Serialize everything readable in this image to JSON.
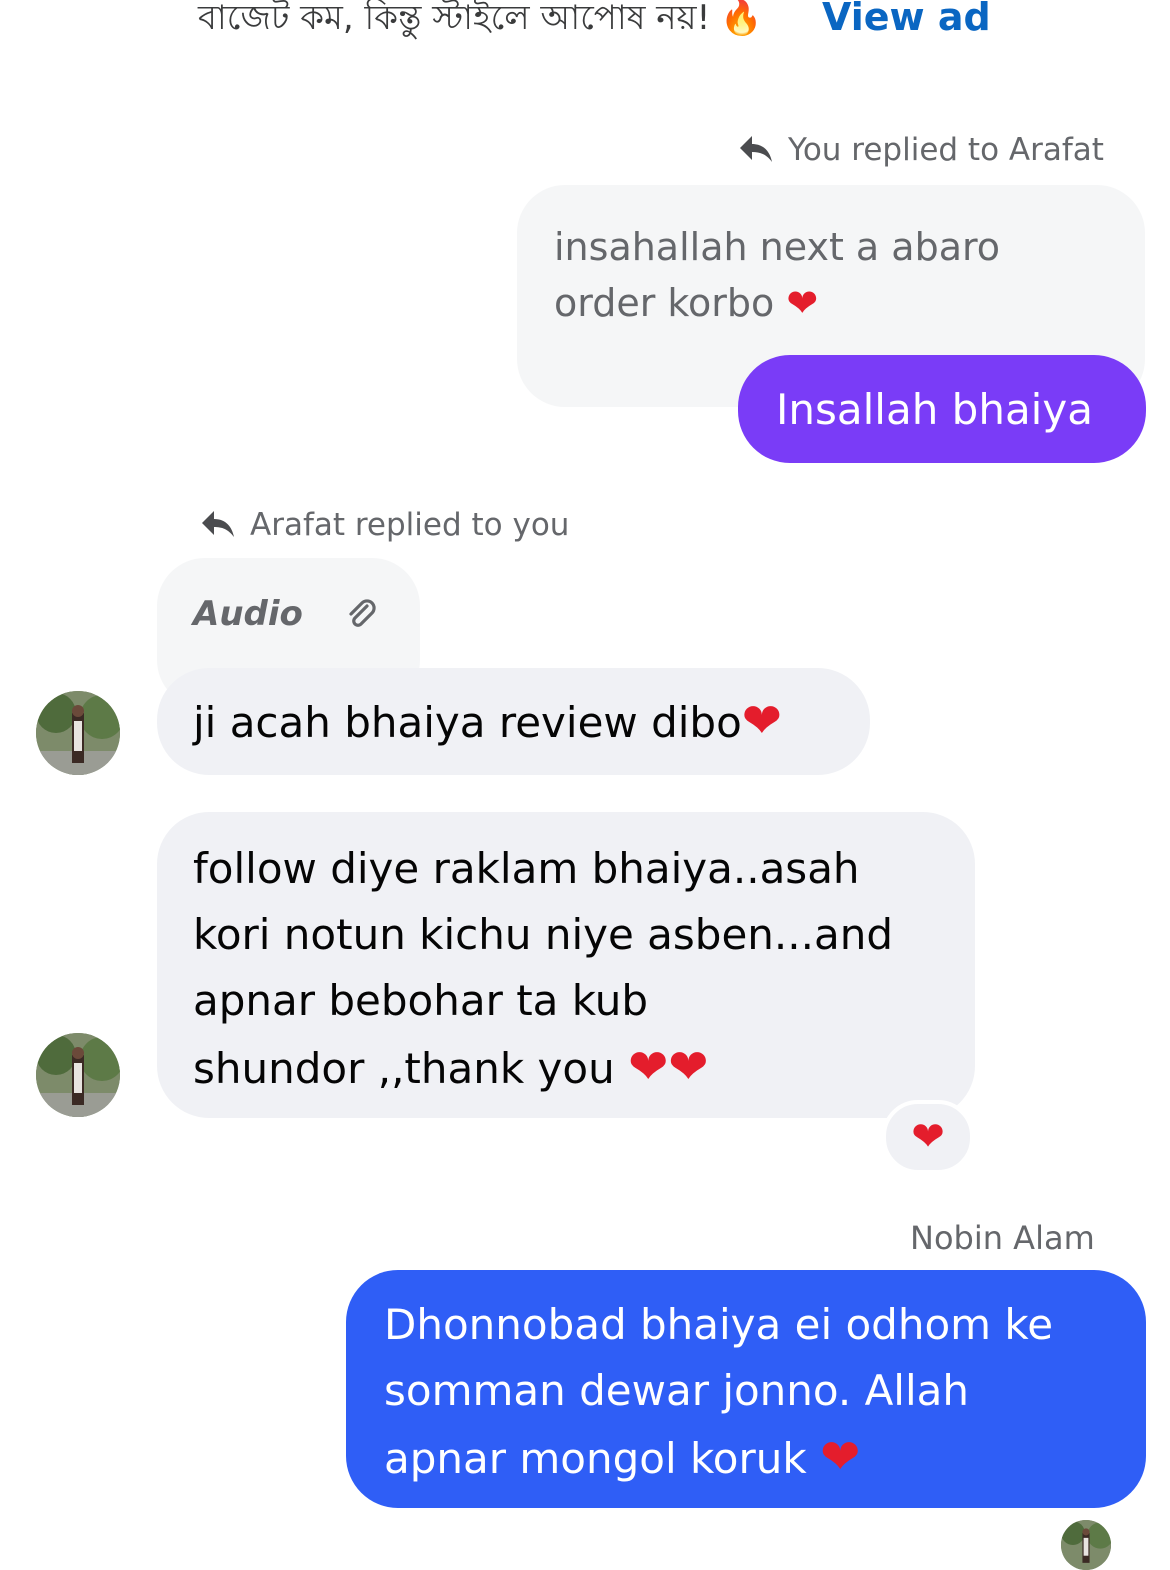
{
  "ad": {
    "text": "বাজেট কম, কিন্তু স্টাইলে আপোষ নয়!",
    "emoji": "🔥",
    "view_ad_label": "View ad"
  },
  "messages": [
    {
      "reply_header": "You replied to Arafat",
      "quoted_text_line1": "insahallah next a abaro",
      "quoted_text_line2": "order korbo",
      "heart": "❤",
      "text": "Insallah bhaiya"
    },
    {
      "reply_header": "Arafat replied to you",
      "quoted_label": "Audio",
      "text": "ji acah bhaiya review dibo",
      "heart": "❤"
    },
    {
      "line1": "follow diye raklam bhaiya..asah",
      "line2": "kori notun kichu niye asben...and",
      "line3": "apnar bebohar ta kub",
      "line4": "shundor ,,thank you",
      "hearts": "❤❤",
      "reaction": "❤"
    },
    {
      "sender": "Nobin Alam",
      "line1": "Dhonnobad bhaiya ei odhom ke",
      "line2": "somman dewar jonno. Allah",
      "line3": "apnar mongol koruk",
      "heart": "❤"
    }
  ],
  "colors": {
    "purple_bubble": "#7a3cf7",
    "blue_bubble": "#2f5ef6",
    "incoming_bubble": "#f0f1f5",
    "link": "#0a66c2",
    "heart": "#e41d2c"
  }
}
